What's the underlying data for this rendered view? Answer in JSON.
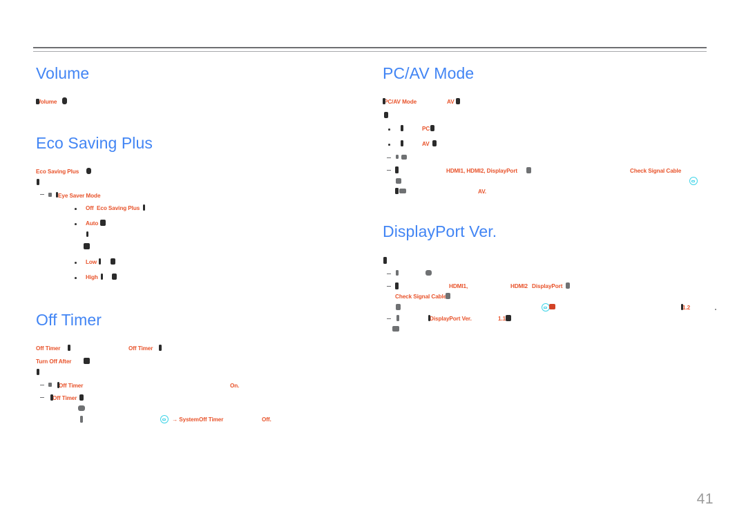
{
  "document": {
    "page_number": "41",
    "colors": {
      "heading": "#4285f4",
      "emphasis": "#e8532b",
      "body": "#3a3a3a",
      "muted": "#808285",
      "icon_accent": "#3fd4e8",
      "rule": "#6d6e71",
      "page_number": "#9b9b9b"
    }
  },
  "left_column": {
    "volume": {
      "heading": "Volume",
      "lines": [
        {
          "id": "vol-l1",
          "segments": [
            {
              "text": "Volume",
              "style": "orange"
            }
          ]
        }
      ]
    },
    "eco_saving_plus": {
      "heading": "Eco Saving Plus",
      "lines": [
        {
          "id": "eco-l1",
          "segments": [
            {
              "text": "Eco Saving Plus",
              "style": "orange"
            }
          ]
        },
        {
          "id": "eco-l2",
          "segments": []
        }
      ],
      "notes": [
        {
          "id": "eco-n1",
          "marker": "dash",
          "segments": [
            {
              "text": "Eye Saver Mode",
              "style": "orange"
            }
          ]
        }
      ],
      "options": [
        {
          "id": "eco-o1",
          "marker": "bullet",
          "label": "Off",
          "trailing": "Eco Saving Plus"
        },
        {
          "id": "eco-o2",
          "marker": "bullet",
          "label": "Auto",
          "trailing": ""
        },
        {
          "id": "eco-o3",
          "marker": "bullet",
          "label": "Low",
          "trailing": ""
        },
        {
          "id": "eco-o4",
          "marker": "bullet",
          "label": "High",
          "trailing": ""
        }
      ]
    },
    "off_timer": {
      "heading": "Off Timer",
      "lines": [
        {
          "id": "ot-l1",
          "segments": [
            {
              "text": "Off Timer",
              "style": "orange"
            },
            {
              "text": "Off Timer",
              "style": "orange"
            }
          ]
        },
        {
          "id": "ot-l2",
          "segments": [
            {
              "text": "Turn Off After",
              "style": "orange"
            }
          ]
        },
        {
          "id": "ot-l3",
          "segments": []
        }
      ],
      "notes": [
        {
          "id": "ot-n1",
          "marker": "dash",
          "segments": [
            {
              "text": "Off Timer",
              "style": "orange"
            },
            {
              "text": "On.",
              "style": "orange"
            }
          ]
        },
        {
          "id": "ot-n2",
          "marker": "dash",
          "segments": [
            {
              "text": "Off Timer",
              "style": "orange"
            }
          ]
        },
        {
          "id": "ot-n3",
          "marker": "none",
          "segments": []
        },
        {
          "id": "ot-n4",
          "marker": "none",
          "icon": "menu-icon",
          "segments": [
            {
              "text": "→ System",
              "style": "orange"
            },
            {
              "text": "Off Timer",
              "style": "orange"
            },
            {
              "text": "Off.",
              "style": "orange"
            }
          ]
        }
      ]
    }
  },
  "right_column": {
    "pc_av_mode": {
      "heading": "PC/AV Mode",
      "lines": [
        {
          "id": "pc-l1",
          "segments": [
            {
              "text": "PC/AV Mode",
              "style": "orange"
            },
            {
              "text": "AV",
              "style": "orange"
            }
          ]
        },
        {
          "id": "pc-l2",
          "segments": []
        }
      ],
      "options": [
        {
          "id": "pc-o1",
          "marker": "bullet",
          "label": "PC"
        },
        {
          "id": "pc-o2",
          "marker": "bullet",
          "label": "AV"
        }
      ],
      "notes": [
        {
          "id": "pc-n1",
          "marker": "dash",
          "segments": []
        },
        {
          "id": "pc-n2",
          "marker": "dash",
          "segments": [
            {
              "text": "HDMI1, HDMI2, DisplayPort",
              "style": "orange"
            },
            {
              "text": "Check Signal Cable",
              "style": "orange"
            }
          ]
        },
        {
          "id": "pc-n3",
          "marker": "none",
          "icon": "menu-icon",
          "segments": []
        },
        {
          "id": "pc-n4",
          "marker": "none",
          "segments": [
            {
              "text": "AV.",
              "style": "orange"
            }
          ]
        }
      ]
    },
    "displayport_ver": {
      "heading": "DisplayPort Ver.",
      "lines": [
        {
          "id": "dp-l1",
          "segments": []
        }
      ],
      "notes": [
        {
          "id": "dp-n1",
          "marker": "dash",
          "segments": []
        },
        {
          "id": "dp-n2",
          "marker": "dash",
          "segments": [
            {
              "text": "HDMI1,",
              "style": "orange"
            },
            {
              "text": "HDMI2",
              "style": "orange"
            },
            {
              "text": "DisplayPort",
              "style": "orange"
            }
          ]
        },
        {
          "id": "dp-n3",
          "marker": "none",
          "segments": [
            {
              "text": "Check Signal Cable",
              "style": "orange"
            }
          ]
        },
        {
          "id": "dp-n4",
          "marker": "none",
          "icon": "menu-icon",
          "segments": [
            {
              "text": "1.2",
              "style": "orange"
            }
          ]
        },
        {
          "id": "dp-n5",
          "marker": "dash",
          "segments": [
            {
              "text": "DisplayPort Ver.",
              "style": "orange"
            },
            {
              "text": "1.1",
              "style": "orange"
            }
          ]
        },
        {
          "id": "dp-n6",
          "marker": "none",
          "segments": []
        }
      ]
    }
  }
}
